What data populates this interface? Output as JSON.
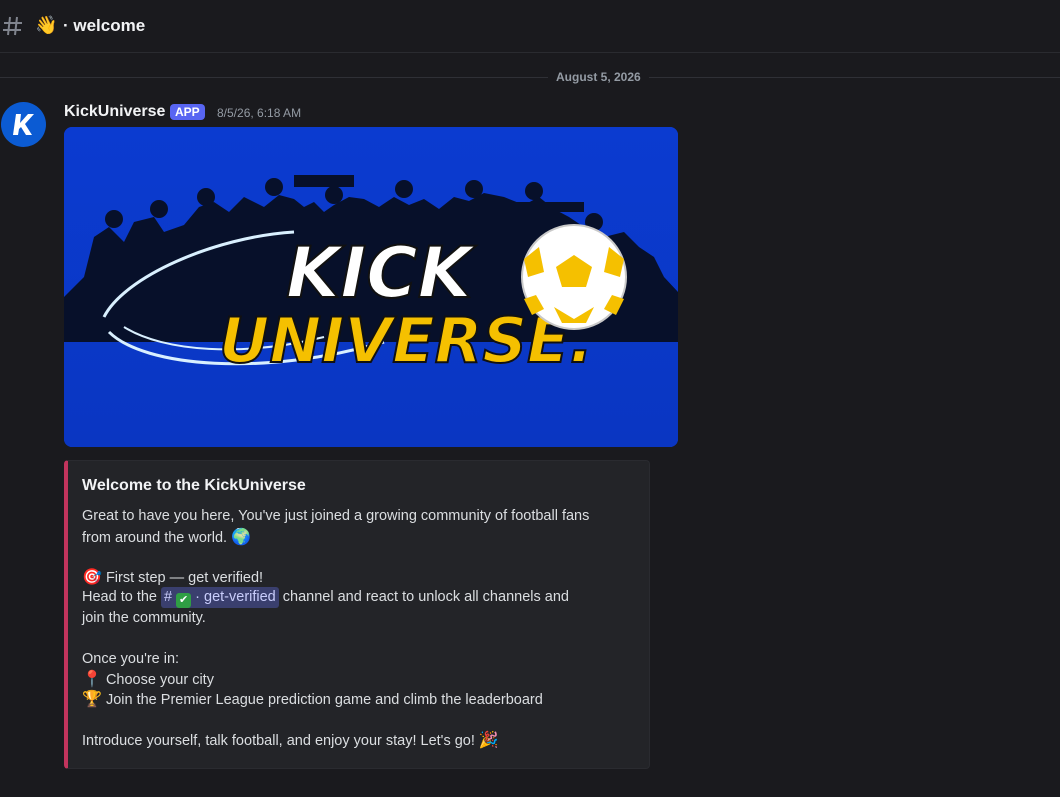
{
  "header": {
    "channel_emoji": "👋",
    "channel_name": "· welcome"
  },
  "divider": {
    "date": "August 5, 2026"
  },
  "message": {
    "author": "KickUniverse",
    "badge": "APP",
    "timestamp": "8/5/26, 6:18 AM",
    "avatar_letter": "K",
    "banner": {
      "line1": "KICK",
      "line2": "UNIVERSE."
    }
  },
  "embed": {
    "title": "Welcome to the KickUniverse",
    "intro_line1": "Great to have you here, You've just joined a growing community of football fans",
    "intro_line2": "from around the world.",
    "intro_emoji": "🌍",
    "step_emoji": "🎯",
    "step_text": "First step — get verified!",
    "head_prefix": "Head to the",
    "mention_hash": "#",
    "mention_check": "✔",
    "mention_name": "· get-verified",
    "head_suffix": "channel and react to unlock all channels and",
    "head_line2": "join the community.",
    "once_in": "Once you're in:",
    "city_emoji": "📍",
    "city_text": "Choose your city",
    "trophy_emoji": "🏆",
    "trophy_text": "Join the Premier League prediction game and climb the leaderboard",
    "outro_text": "Introduce yourself, talk football, and enjoy your stay! Let's go!",
    "outro_emoji": "🎉"
  },
  "colors": {
    "background": "#1a1a1e",
    "embed_accent": "#c2345d",
    "badge": "#5865f2",
    "banner_blue": "#0c3ecf",
    "banner_yellow": "#f5c000"
  },
  "icons": {
    "channel": "hash-icon",
    "avatar": "kickuniverse-logo-icon"
  }
}
